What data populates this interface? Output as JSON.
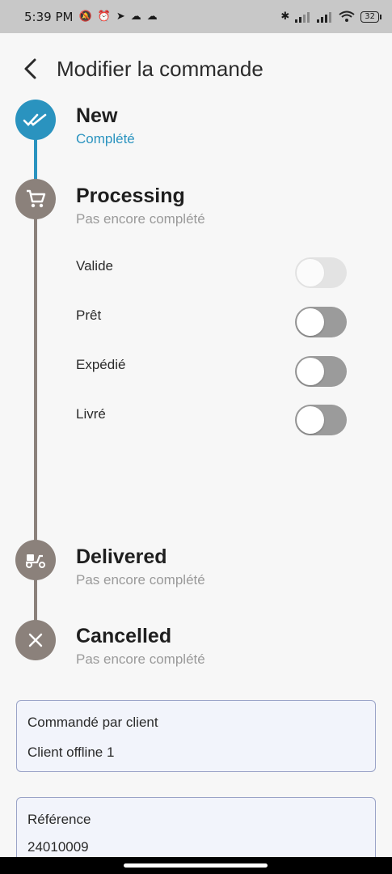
{
  "status_bar": {
    "time": "5:39 PM",
    "left_icons": [
      "mute-bell-icon",
      "alarm-icon",
      "telegram-icon",
      "cloud-icon",
      "cloud-icon"
    ],
    "right_icons": [
      "bluetooth-icon",
      "signal-icon",
      "signal-icon",
      "wifi-icon"
    ],
    "battery": "32"
  },
  "header": {
    "title": "Modifier la commande"
  },
  "steps": [
    {
      "title": "New",
      "status": "Complété",
      "completed": true,
      "icon": "double-check-icon"
    },
    {
      "title": "Processing",
      "status": "Pas encore complété",
      "completed": false,
      "icon": "cart-icon"
    },
    {
      "title": "Delivered",
      "status": "Pas encore complété",
      "completed": false,
      "icon": "scooter-icon"
    },
    {
      "title": "Cancelled",
      "status": "Pas encore complété",
      "completed": false,
      "icon": "close-icon"
    }
  ],
  "processing_options": [
    {
      "label": "Valide",
      "on": false,
      "enabled": false
    },
    {
      "label": "Prêt",
      "on": false,
      "enabled": true
    },
    {
      "label": "Expédié",
      "on": false,
      "enabled": true
    },
    {
      "label": "Livré",
      "on": false,
      "enabled": true
    }
  ],
  "fields": {
    "ordered_by_label": "Commandé par client",
    "ordered_by_value": "Client offline 1",
    "reference_label": "Référence",
    "reference_value": "24010009"
  },
  "colors": {
    "completed": "#2a93bf",
    "pending": "#8b817b",
    "field_border": "#9aa3c7"
  }
}
